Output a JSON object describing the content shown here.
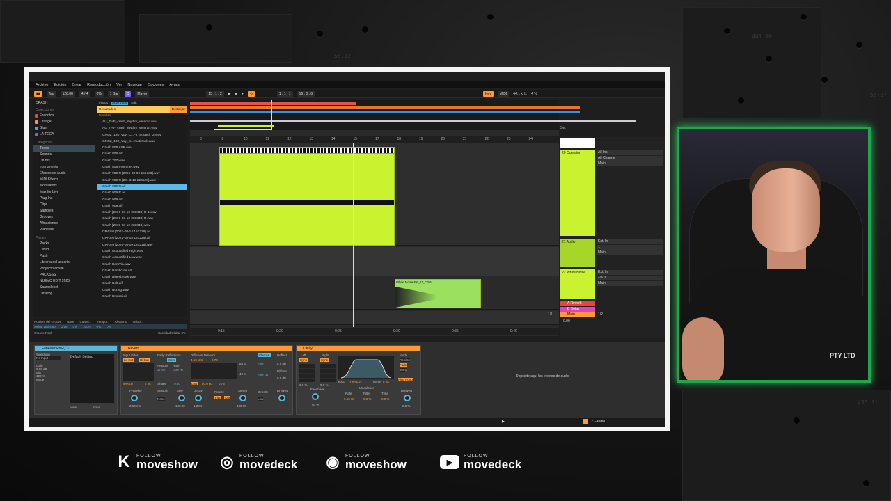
{
  "menu": [
    "Archivo",
    "Edición",
    "Crear",
    "Reproducción",
    "Ver",
    "Navegar",
    "Opciones",
    "Ayuda"
  ],
  "transport": {
    "tap": "Tap",
    "tempo": "128.00",
    "sig": "4 / 4",
    "pct": "0%",
    "bar": "1 Bar",
    "key": "C",
    "scale": "Mayor",
    "pos": "15 . 1 . 2",
    "loop_start": "1 . 1 . 1",
    "loop_len": "16 . 0 . 0",
    "key_label": "Key",
    "midi_label": "MIDI",
    "rate": "44.1 kHz",
    "cpu": "4 %"
  },
  "browser": {
    "title": "CRASH",
    "filters_label": "Filtros",
    "autotags_label": "Auto Tags",
    "edit_label": "Edit",
    "results_label": "Resultados",
    "clear_label": "Despejar",
    "name_header": "Nombre",
    "collections_header": "Colecciones",
    "collections": [
      {
        "label": "Favoritos",
        "color": "#e8463c"
      },
      {
        "label": "Orange",
        "color": "#ff9a2e"
      },
      {
        "label": "Blue",
        "color": "#4aa3f0"
      },
      {
        "label": "LA TECA",
        "color": "#7a5cff"
      }
    ],
    "categories_header": "Categorías",
    "categories": [
      "Todos",
      "Sounds",
      "Drums",
      "Instruments",
      "Efectos de Audio",
      "MIDI Effects",
      "Modulators",
      "Max for Live",
      "Plug-Ins",
      "Clips",
      "Samples",
      "Grooves",
      "Afinaciones",
      "Plantillas"
    ],
    "places_header": "Places",
    "places": [
      "Packs",
      "Cloud",
      "Push",
      "Librería del usuario",
      "Proyecto actual",
      "PACKSSS",
      "NUEVO EDIT 2025",
      "Saampleset",
      "Desktop"
    ],
    "files": [
      "AU_THF_crash_rhythm_veteran.wav",
      "AU_THF_crash_rhythm_veteran.wav",
      "GNDZ_130_Voy_C...Fx_Scratch_2.wav",
      "GNDZ_130_Voy_C...multitrack.wav",
      "Crash 808 ASR.wav",
      "Crash 808.aif",
      "Crash 707.wav",
      "Crash 808 Prommer.wav",
      "Crash 909 R [2025-08-06 165733].wav",
      "Crash 909 R [20...3-12 224528].wav",
      "Crash 909 R.aif",
      "Crash 909 R.aif",
      "Crash 909.aif",
      "Crash 909.aif",
      "Crash [2019-03-12 203848] R-1.wav",
      "Crash [2019-03-12 203848] R.wav",
      "Crash [2019-03-12 203848].wav",
      "CRASH [2022-08-14 151226].aif",
      "CRASH [2022-08-14 151226].aif",
      "CRASH [2025-05-09 120215].wav",
      "Crash Acoustified High.wav",
      "Crash Acoustified Low.wav",
      "Crash BamVin.wav",
      "Crash Bandicute.aif",
      "Crash Bluesbreak.wav",
      "Crash Bolt.aif",
      "Crash Boring.wav",
      "Crash Brkroni.aif"
    ],
    "selected_index": 10,
    "groove_headers": [
      "Nombre del Groove",
      "Base",
      "Cuanti...",
      "Tempo...",
      "Aleatorio",
      "Veloci..."
    ],
    "groove_row": [
      "Swing 16ths 60",
      "1/16",
      "0%",
      "100%",
      "0%",
      "0%"
    ],
    "groove_pool": "Groove Pool",
    "global_amount": "Cantidad Global",
    "global_pct": "0%"
  },
  "arrangement": {
    "ruler": [
      "6",
      "8",
      "10",
      "11",
      "12",
      "13",
      "14",
      "15",
      "17",
      "18",
      "19",
      "20",
      "21",
      "22",
      "23",
      "24"
    ],
    "time_ruler": [
      "0:15",
      "0:20",
      "0:25",
      "0:30",
      "0:35",
      "0:40"
    ],
    "clip_b_label": "White Noise FX_01_C3 6"
  },
  "mixer": {
    "set_label": "Set",
    "tracks": [
      {
        "name": "20 Operator",
        "in": "All Ins",
        "ch": "All Channe",
        "out": "Main",
        "vol": "20"
      },
      {
        "name": "21 Audio",
        "in": "Ext. In",
        "ch": "1",
        "out": "Main",
        "vol": "21"
      },
      {
        "name": "22 White Noise",
        "in": "Ext. In",
        "ch": "1",
        "out": "Main",
        "vol": "22",
        "db": "-26.3"
      }
    ],
    "returns": [
      "A Reverb",
      "B Delay"
    ],
    "main": "Main",
    "main_ratio": "1/2",
    "main_val": "0.00",
    "loop": "1/1"
  },
  "devices": {
    "fabfilter": {
      "title": "FabFilter Pro-Q 3",
      "sidechain": "Sidechain",
      "no_input": "No Input",
      "gain": "Gain",
      "gain_val": "0.00 dB",
      "mix": "Mix",
      "mix_val": "100 %",
      "mode": "Mode",
      "preset": "Default Setting",
      "none1": "none",
      "none2": "none"
    },
    "reverb": {
      "title": "Reverb",
      "input": "Input Filter",
      "low": "Lo Cut",
      "hi": "Hi Cut",
      "early": "Early Reflections",
      "spin": "Spin",
      "amount": "Amount",
      "rate": "Rate",
      "amount_val": "17.50",
      "rate_val": "0.30 Hz",
      "diffusion": "Diffusion Network",
      "shape": "Shape",
      "shape_val": "0.50",
      "freq1": "830 Hz",
      "freq2": "5.85",
      "chorus": "Chorus",
      "reflect": "Reflect",
      "diffuse": "Diffuse",
      "predelay": "Predelay",
      "smooth": "Smooth",
      "size": "Size",
      "decay": "Decay",
      "freeze": "Freeze",
      "stereo": "Stereo",
      "density": "Density",
      "drywet": "Dry/Wet",
      "pd_val": "2.50 ms",
      "sm_val": "None",
      "sz_val": "100.00",
      "dc_val": "1.20 s",
      "st_val": "100.00",
      "den_val": "Low",
      "hf": "4.50 kHz",
      "hfv": "0.70",
      "lfv": "80.0 Hz",
      "lf2": "0.75",
      "amt2": "60 %",
      "rate2": "40 %",
      "amt3": "0.02",
      "rate3": "0.02 Hz",
      "db_reflect": "0.0 dB",
      "db_diffuse": "0.0 dB",
      "fl": "Flat",
      "cut": "Cut",
      "low2": "Low"
    },
    "delay": {
      "title": "Delay",
      "left": "Left",
      "right": "Right",
      "sync": "Sync",
      "time": "Time",
      "pct1": "0.0 %",
      "pct2": "0.0 %",
      "filter": "Filter",
      "filter_val": "1.00 kHz",
      "width": "Width",
      "width_val": "8.00",
      "modulation": "Modulation",
      "rate": "Rate",
      "rate_val": "0.50 Hz",
      "filt": "Filter",
      "filt_val": "0.0 %",
      "tm": "Time",
      "tm_val": "0.0 %",
      "feedback": "Feedback",
      "fb_val": "50 %",
      "mode": "Mode",
      "repitch": "Repitch",
      "fade": "Fade",
      "jump": "Jump",
      "pingpong": "Ping Pong",
      "drywet": "Dry/Wet",
      "dw_val": "0.0 %"
    },
    "drop_hint": "Deposite aquí los efectos de audio"
  },
  "status": {
    "track": "21-Audio"
  },
  "bg_numbers": [
    "58.12",
    "401.90",
    "58:37",
    "436.51"
  ],
  "socials": [
    {
      "icon": "K",
      "follow": "FOLLOW",
      "name": "moveshow"
    },
    {
      "icon": "◎",
      "follow": "FOLLOW",
      "name": "movedeck"
    },
    {
      "icon": "◉",
      "follow": "FOLLOW",
      "name": "moveshow"
    },
    {
      "icon": "▶",
      "follow": "FOLLOW",
      "name": "movedeck"
    }
  ],
  "webcam": {
    "shirt_text": "PTY LTD"
  },
  "colors": {
    "accent": "#ff9a2e",
    "clip": "#c8f32e",
    "cam_border": "#1ea64b"
  }
}
